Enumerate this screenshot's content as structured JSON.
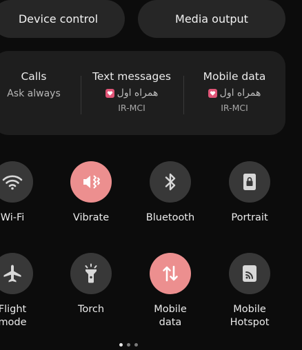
{
  "pills": {
    "device_control": "Device control",
    "media_output": "Media output"
  },
  "sim": {
    "calls": {
      "title": "Calls",
      "value": "Ask always"
    },
    "texts": {
      "title": "Text messages",
      "carrier": "همراه اول",
      "sim_name": "IR-MCI"
    },
    "data": {
      "title": "Mobile data",
      "carrier": "همراه اول",
      "sim_name": "IR-MCI"
    }
  },
  "tiles": {
    "wifi": {
      "label": "Wi-Fi",
      "icon": "wifi-icon",
      "active": false
    },
    "vibrate": {
      "label": "Vibrate",
      "icon": "vibrate-icon",
      "active": true
    },
    "bluetooth": {
      "label": "Bluetooth",
      "icon": "bluetooth-icon",
      "active": false
    },
    "portrait": {
      "label": "Portrait",
      "icon": "portrait-lock-icon",
      "active": false
    },
    "flight": {
      "label_line1": "Flight",
      "label_line2": "mode",
      "icon": "airplane-icon",
      "active": false
    },
    "torch": {
      "label": "Torch",
      "icon": "flashlight-icon",
      "active": false
    },
    "mobile_data": {
      "label_line1": "Mobile",
      "label_line2": "data",
      "icon": "data-transfer-icon",
      "active": true
    },
    "hotspot": {
      "label_line1": "Mobile",
      "label_line2": "Hotspot",
      "icon": "hotspot-icon",
      "active": false
    }
  },
  "pager": {
    "pages": 3,
    "current": 1
  },
  "colors": {
    "active_tile": "#ec8f8f",
    "inactive_tile": "#383838",
    "sim_badge": "#e05577",
    "background": "#0c0c0c"
  }
}
